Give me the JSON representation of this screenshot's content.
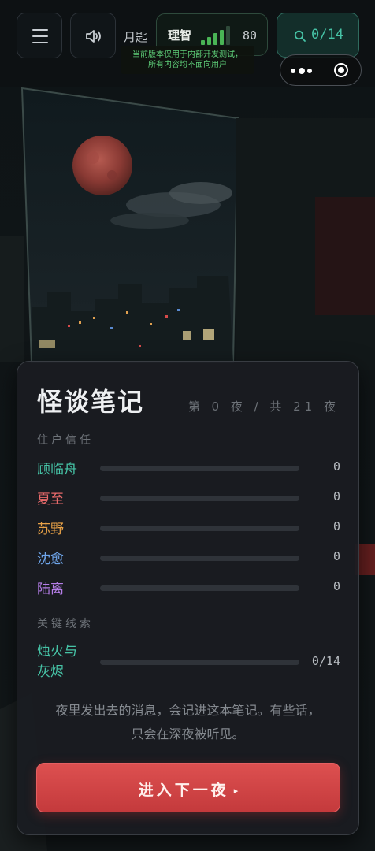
{
  "topbar": {
    "menu_icon": "hamburger-icon",
    "sound_icon": "speaker-icon",
    "moon_label": "月匙",
    "sanity": {
      "label": "理智",
      "value": "80",
      "level": 0.8,
      "bar_color": "#49b455"
    },
    "search": {
      "icon": "search-icon",
      "count": "0/14"
    },
    "dev_notice": [
      "当前版本仅用于内部开发测试，",
      "所有内容均不面向用户"
    ]
  },
  "capsule": {
    "more_icon": "more-dots-icon",
    "close_icon": "target-circle-icon"
  },
  "card": {
    "title": "怪谈笔记",
    "night_count": "第 0 夜 / 共 21 夜",
    "trust_label": "住户信任",
    "residents": [
      {
        "name": "顾临舟",
        "value": "0",
        "color": "#46c3a6"
      },
      {
        "name": "夏至",
        "value": "0",
        "color": "#e76a6a"
      },
      {
        "name": "苏野",
        "value": "0",
        "color": "#e9a247"
      },
      {
        "name": "沈愈",
        "value": "0",
        "color": "#6fa6ec"
      },
      {
        "name": "陆离",
        "value": "0",
        "color": "#b57ee8"
      }
    ],
    "clues_label": "关键线索",
    "clue": {
      "name": "烛火与灰烬",
      "value": "0/14",
      "progress": 0
    },
    "note_lines": [
      "夜里发出去的消息，会记进这本笔记。有些话，",
      "只会在深夜被听见。"
    ],
    "next_button": "进入下一夜",
    "next_arrow": "▸"
  },
  "colors": {
    "accent_teal": "#46c3a6",
    "button_red": "#d44848"
  }
}
